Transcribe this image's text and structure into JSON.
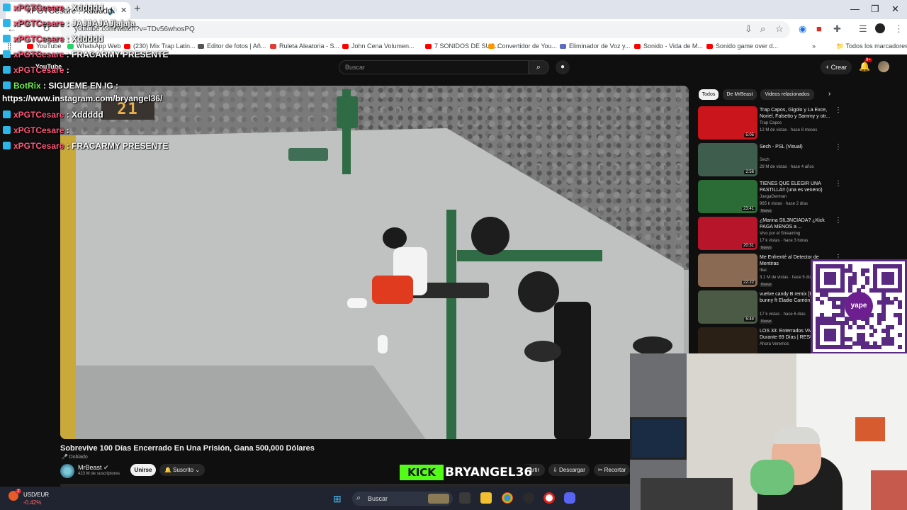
{
  "browser": {
    "tab_title": "xPGTCesare : Xddddd",
    "url": "youtube.com/watch?v=TDv56whosPQ",
    "bookmarks": [
      {
        "label": "YouTube",
        "color": "#ff0000"
      },
      {
        "label": "WhatsApp Web",
        "color": "#25d366"
      },
      {
        "label": "(230) Mix Trap Latin...",
        "color": "#ff0000"
      },
      {
        "label": "Editor de fotos | Añ...",
        "color": "#555555"
      },
      {
        "label": "Ruleta Aleatoria - S...",
        "color": "#e53935"
      },
      {
        "label": "John Cena Volumen...",
        "color": "#ff0000"
      },
      {
        "label": "7 SONIDOS DE SUS...",
        "color": "#ff0000"
      },
      {
        "label": "Convertidor de You...",
        "color": "#ff9800"
      },
      {
        "label": "Eliminador de Voz y...",
        "color": "#5c6bc0"
      },
      {
        "label": "Sonido - Vida de M...",
        "color": "#ff0000"
      },
      {
        "label": "Sonido game over d...",
        "color": "#ff0000"
      }
    ],
    "all_bookmarks": "Todos los marcadores"
  },
  "youtube": {
    "logo": "YouTube",
    "search_placeholder": "Buscar",
    "create": "Crear",
    "notif_count": "9+"
  },
  "video": {
    "score_overlay": "21",
    "title": "Sobrevive 100 Días Encerrado En Una Prisión, Gana 500,000 Dólares",
    "dubbed": "Doblado",
    "channel": "MrBeast",
    "subscribers": "423 M de suscriptores",
    "join": "Unirse",
    "subscribed": "Suscrito",
    "share": "partir",
    "download": "Descargar",
    "clip": "Recortar"
  },
  "sidebar": {
    "chips": [
      "Todos",
      "De MrBeast",
      "Videos relacionados"
    ],
    "recommendations": [
      {
        "title": "Trap Capos, Gigolo y La Exce, Noriel, Falsetto y Sammy y otr...",
        "channel": "Trap Capos",
        "meta": "12 M de vistas · hace 8 meses",
        "duration": "5:05",
        "badge": "",
        "thumb": "#c9151b"
      },
      {
        "title": "Sech - PSL (Visual)",
        "channel": "Sech",
        "meta": "29 M de vistas · hace 4 años",
        "duration": "2:56",
        "badge": "",
        "thumb": "#3f5d4c"
      },
      {
        "title": "TIENES QUE ELEGIR UNA PASTILLA!! (una es veneno)",
        "channel": "JuegaGerman",
        "meta": "965 k vistas · hace 2 días",
        "duration": "23:41",
        "badge": "Nuevo",
        "thumb": "#2b6b35"
      },
      {
        "title": "¿Marina SIL3NCIADA? ¿Kick PAGA MENOS a ...",
        "channel": "Vivo por el Streaming",
        "meta": "17 k vistas · hace 3 horas",
        "duration": "20:31",
        "badge": "Nuevo",
        "thumb": "#b7152a"
      },
      {
        "title": "Me Enfrenté al Detector de Mentiras",
        "channel": "Ibai",
        "meta": "3.1 M de vistas · hace 5 días",
        "duration": "22:22",
        "badge": "Nuevo",
        "thumb": "#8a6a52"
      },
      {
        "title": "vuelve candy B remix [Bad bunny ft Eladio Carrión]",
        "channel": "",
        "meta": "17 k vistas · hace 6 días",
        "duration": "5:44",
        "badge": "Nuevo",
        "thumb": "#4a5a44"
      },
      {
        "title": "LOS 33: Enterrados Vivos Durante 69 Días | RESU...",
        "channel": "Ahora Veremos",
        "meta": "",
        "duration": "",
        "badge": "",
        "thumb": "#2a2015"
      }
    ]
  },
  "overlay": {
    "qr_logo": "yape",
    "kick_logo": "KICK",
    "kick_user": "BRYANGEL36",
    "chat": [
      {
        "user": "xPGTCesare",
        "text": ": Xddddd"
      },
      {
        "user": "xPGTCesare",
        "text": ": JAJJAJAJjajaja"
      },
      {
        "user": "xPGTCesare",
        "text": ": Xddddd"
      },
      {
        "user": "xPGTCesare",
        "text": ": FRACARMY PRESENTE"
      },
      {
        "user": "xPGTCesare",
        "text": ":"
      },
      {
        "user": "BotRix",
        "text": ": SIGUEME EN IG :"
      },
      {
        "user": "",
        "text": "https://www.instagram.com/bryangel36/"
      },
      {
        "user": "xPGTCesare",
        "text": ": Xddddd"
      },
      {
        "user": "xPGTCesare",
        "text": ":"
      },
      {
        "user": "xPGTCesare",
        "text": ": FRACARMY PRESENTE"
      }
    ]
  },
  "taskbar": {
    "ticker_name": "USD/EUR",
    "ticker_change": "-0.42%",
    "ticker_badge": "2",
    "search": "Buscar"
  }
}
